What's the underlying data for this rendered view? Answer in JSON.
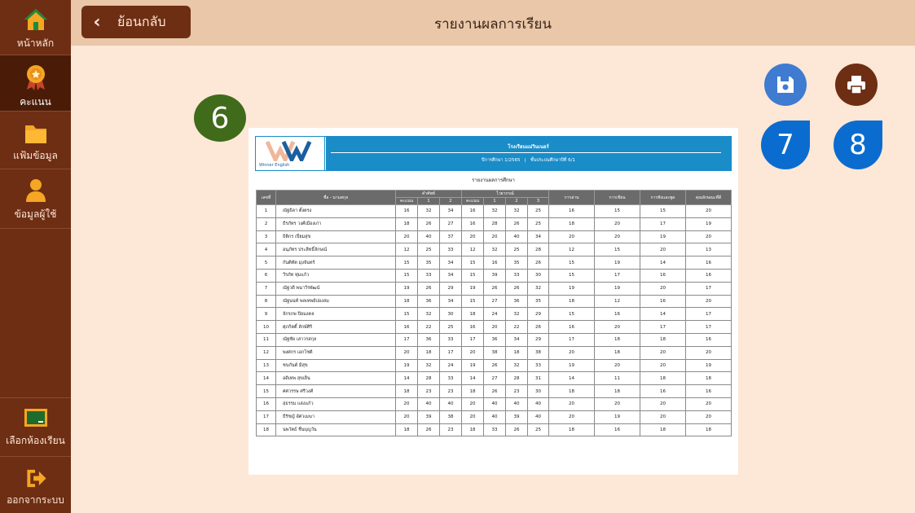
{
  "sidebar": {
    "items": [
      {
        "label": "หน้าหลัก",
        "icon": "home-icon"
      },
      {
        "label": "คะแนน",
        "icon": "medal-icon"
      },
      {
        "label": "แฟ้มข้อมูล",
        "icon": "folder-icon"
      },
      {
        "label": "ข้อมูลผู้ใช้",
        "icon": "user-icon"
      }
    ],
    "bottom": [
      {
        "label": "เลือกห้องเรียน",
        "icon": "classroom-board-icon"
      },
      {
        "label": "ออกจากระบบ",
        "icon": "logout-icon"
      }
    ]
  },
  "header": {
    "back_label": "ย้อนกลับ",
    "title": "รายงานผลการเรียน"
  },
  "markers": {
    "sheet": "6",
    "save": "7",
    "print": "8"
  },
  "colors": {
    "sidebar": "#6e2e14",
    "sidebar_active": "#4a1c08",
    "topbar": "#e9c7a8",
    "background": "#fde7d6",
    "save_button": "#3e7bd1",
    "print_button": "#6e2e14",
    "marker_green": "#3f6b1b",
    "marker_blue": "#0b6ccf",
    "report_blue": "#1a8cc8"
  },
  "report": {
    "logo_text": "Winner English",
    "school": "โรงเรียนแม่วินเนอร์",
    "year": "ปีการศึกษา 1/2565",
    "grade": "ชั้นประถมศึกษาปีที่ 6/1",
    "subtitle": "รายงานผลการศึกษา",
    "headers": {
      "no": "เลขที่",
      "name": "ชื่อ - นามสกุล",
      "group1": "คำศัพท์",
      "group2": "ไวยากรณ์",
      "total": "คะแนน",
      "c1": "1",
      "c2": "2",
      "c3": "3",
      "reading": "การอ่าน",
      "writing": "การเขียน",
      "listening": "การฟังและพูด",
      "attitude": "คุณลักษณะที่ดี"
    },
    "rows": [
      {
        "no": "1",
        "name": "ณัฐธิดา ตั้งตรง",
        "v": [
          "16",
          "32",
          "34",
          "16",
          "32",
          "32",
          "25",
          "16",
          "15",
          "15",
          "20"
        ]
      },
      {
        "no": "2",
        "name": "ธีรภัทร วงศ์เมืองเก่า",
        "v": [
          "18",
          "26",
          "27",
          "16",
          "28",
          "26",
          "25",
          "18",
          "20",
          "17",
          "19"
        ]
      },
      {
        "no": "3",
        "name": "ธิติกร เปี่ยมสุข",
        "v": [
          "20",
          "40",
          "37",
          "20",
          "20",
          "40",
          "34",
          "20",
          "20",
          "19",
          "20"
        ]
      },
      {
        "no": "4",
        "name": "อนุภัทร ประสิทธิ์ลักษณ์",
        "v": [
          "12",
          "25",
          "33",
          "12",
          "32",
          "25",
          "28",
          "12",
          "15",
          "20",
          "13"
        ]
      },
      {
        "no": "5",
        "name": "กันติทัต มุ่งจันทร์",
        "v": [
          "15",
          "35",
          "34",
          "15",
          "16",
          "35",
          "26",
          "15",
          "19",
          "14",
          "16"
        ]
      },
      {
        "no": "6",
        "name": "วีรภัท ทุ่มแก้ว",
        "v": [
          "15",
          "33",
          "34",
          "15",
          "39",
          "33",
          "30",
          "15",
          "17",
          "16",
          "16"
        ]
      },
      {
        "no": "7",
        "name": "ณัฐวดี พนาวีรพัฒน์",
        "v": [
          "19",
          "26",
          "29",
          "19",
          "26",
          "26",
          "32",
          "19",
          "19",
          "20",
          "17"
        ]
      },
      {
        "no": "8",
        "name": "ณัฐนนท์ พลเทพย์ปองสม",
        "v": [
          "18",
          "36",
          "34",
          "15",
          "27",
          "36",
          "35",
          "18",
          "12",
          "16",
          "20"
        ]
      },
      {
        "no": "9",
        "name": "จักรภพ ปิยมงคล",
        "v": [
          "15",
          "32",
          "30",
          "18",
          "24",
          "32",
          "29",
          "15",
          "16",
          "14",
          "17"
        ]
      },
      {
        "no": "10",
        "name": "ศุภกิตติ์ ลักษ์ศิริ",
        "v": [
          "16",
          "22",
          "25",
          "16",
          "20",
          "22",
          "26",
          "16",
          "20",
          "17",
          "17"
        ]
      },
      {
        "no": "11",
        "name": "ณัฐชัย เสาวรสกุล",
        "v": [
          "17",
          "36",
          "33",
          "17",
          "36",
          "34",
          "29",
          "17",
          "18",
          "18",
          "16"
        ]
      },
      {
        "no": "12",
        "name": "พงศกร เอกโชติ",
        "v": [
          "20",
          "18",
          "17",
          "20",
          "38",
          "18",
          "38",
          "20",
          "18",
          "20",
          "20"
        ]
      },
      {
        "no": "13",
        "name": "ชนกันต์ มีสุข",
        "v": [
          "19",
          "32",
          "24",
          "19",
          "26",
          "32",
          "33",
          "19",
          "20",
          "20",
          "19"
        ]
      },
      {
        "no": "14",
        "name": "อดิเทพ สุขเย็น",
        "v": [
          "14",
          "28",
          "33",
          "14",
          "27",
          "28",
          "31",
          "14",
          "11",
          "18",
          "18"
        ]
      },
      {
        "no": "15",
        "name": "ศศวรรษ ศรีวงศ์",
        "v": [
          "18",
          "23",
          "23",
          "18",
          "26",
          "23",
          "30",
          "18",
          "18",
          "16",
          "16"
        ]
      },
      {
        "no": "16",
        "name": "สุธรรม แสงแก้ว",
        "v": [
          "20",
          "40",
          "40",
          "20",
          "40",
          "40",
          "40",
          "20",
          "20",
          "20",
          "20"
        ]
      },
      {
        "no": "17",
        "name": "ธีรัชญ์ อัศวเมฆา",
        "v": [
          "20",
          "39",
          "38",
          "20",
          "40",
          "39",
          "40",
          "20",
          "19",
          "20",
          "20"
        ]
      },
      {
        "no": "18",
        "name": "นพวัตธ์ ชื่นบุญวัน",
        "v": [
          "18",
          "26",
          "23",
          "18",
          "33",
          "26",
          "25",
          "18",
          "16",
          "18",
          "18"
        ]
      }
    ]
  }
}
